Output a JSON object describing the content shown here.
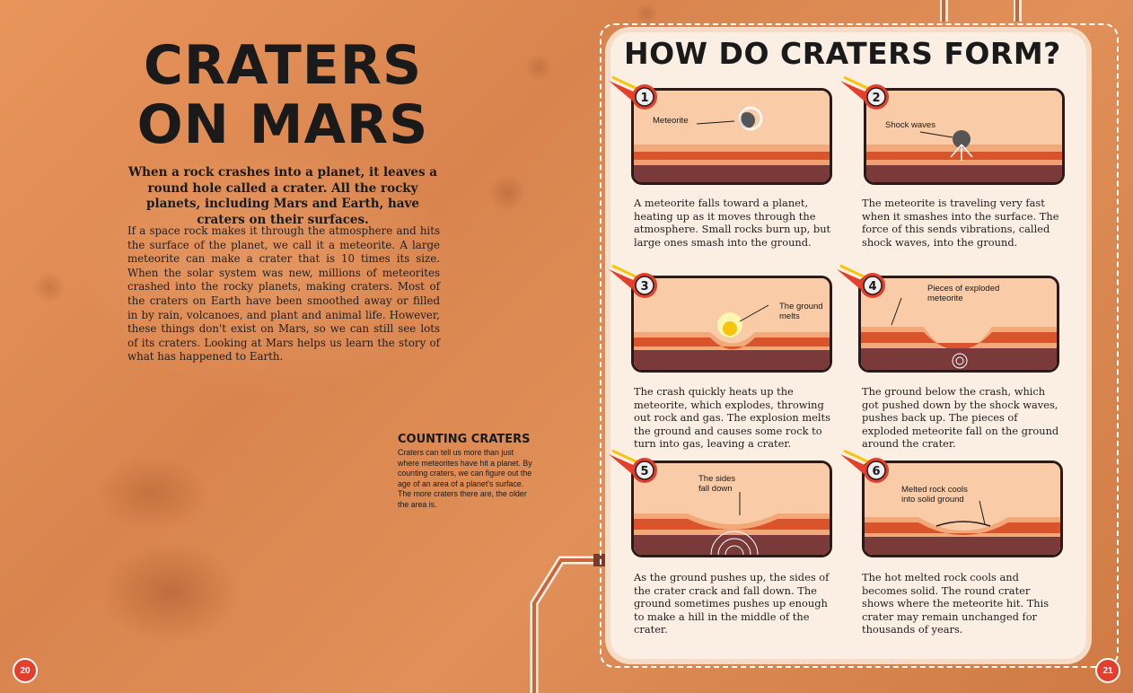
{
  "left_page": {
    "title": "CRATERS\nON MARS",
    "intro": "When a rock crashes into a planet, it leaves a round hole called a crater. All the rocky planets, including Mars and Earth, have craters on their surfaces.",
    "body": "If a space rock makes it through the atmosphere and hits the surface of the planet, we call it a meteorite. A large meteorite can make a crater that is 10 times its size. When the solar system was new, millions of meteorites crashed into the rocky planets, making craters. Most of the craters on Earth have been smoothed away or filled in by rain, volcanoes, and plant and animal life. However, these things don't exist on Mars, so we can still see lots of its craters. Looking at Mars helps us learn the story of what has happened to Earth.",
    "counting_title": "COUNTING CRATERS",
    "counting_text": "Craters can tell us more than just where meteorites have hit a planet. By counting craters, we can figure out the age of an area of a planet's surface. The more craters there are, the older the area is.",
    "page_number": "20"
  },
  "right_page": {
    "title": "HOW DO CRATERS FORM?",
    "page_number": "21",
    "steps": [
      {
        "number": "1",
        "label": "Meteorite",
        "text": "A meteorite falls toward a planet, heating up as it moves through the atmosphere. Small rocks burn up, but large ones smash into the ground."
      },
      {
        "number": "2",
        "label": "Shock waves",
        "text": "The meteorite is traveling very fast when it smashes into the surface. The force of this sends vibrations, called shock waves, into the ground."
      },
      {
        "number": "3",
        "label": "The ground melts",
        "text": "The crash quickly heats up the meteorite, which explodes, throwing out rock and gas. The explosion melts the ground and causes some rock to turn into gas, leaving a crater."
      },
      {
        "number": "4",
        "label": "Pieces of exploded meteorite",
        "text": "The ground below the crash, which got pushed down by the shock waves, pushes back up. The pieces of exploded meteorite fall on the ground around the crater."
      },
      {
        "number": "5",
        "label": "The sides fall down",
        "text": "As the ground pushes up, the sides of the crater crack and fall down. The ground sometimes pushes up enough to make a hill in the middle of the crater."
      },
      {
        "number": "6",
        "label": "Melted rock cools into solid ground",
        "text": "The hot melted rock cools and becomes solid. The round crater shows where the meteorite hit. This crater may remain unchanged for thousands of years."
      }
    ]
  },
  "colors": {
    "page_badge": "#e2402d",
    "panel": "#fbeee3",
    "text": "#1a1a1a",
    "ground_dark": "#7a3a3a",
    "ground_red": "#d9532b"
  }
}
